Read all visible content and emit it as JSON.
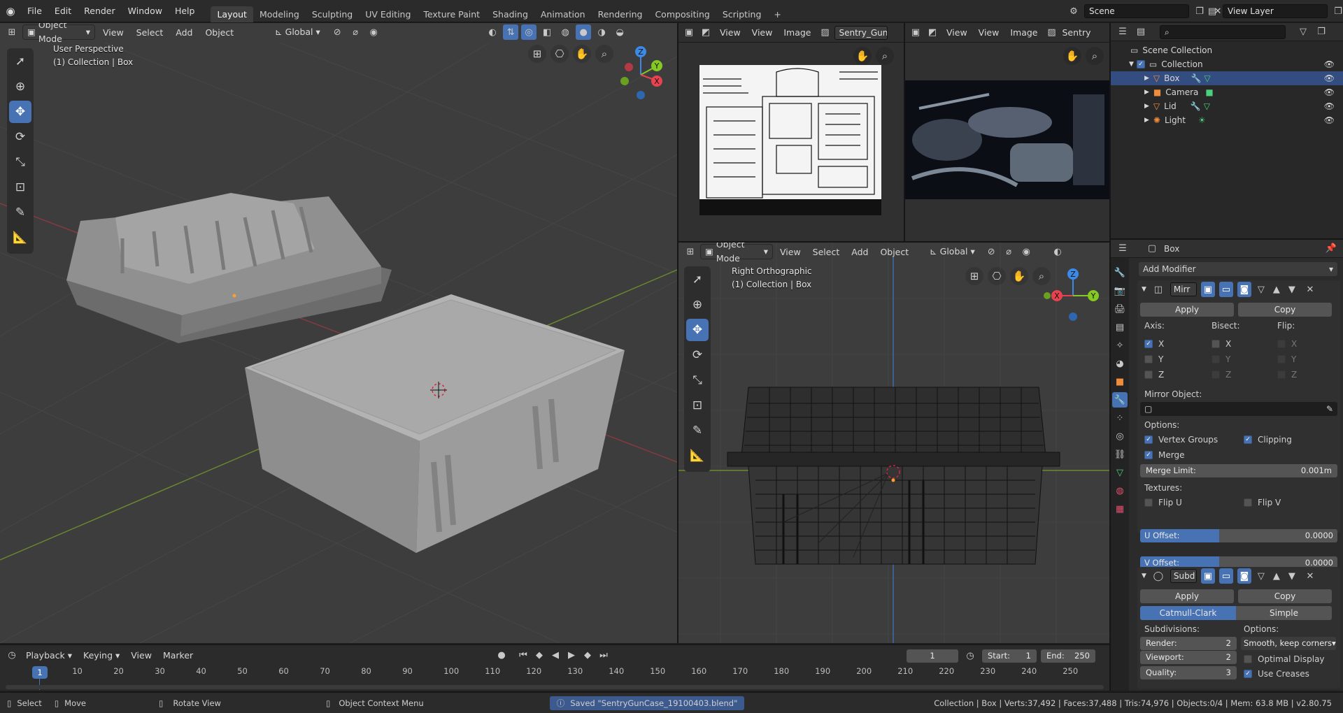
{
  "topbar": {
    "menus": [
      "File",
      "Edit",
      "Render",
      "Window",
      "Help"
    ],
    "workspaces": [
      "Layout",
      "Modeling",
      "Sculpting",
      "UV Editing",
      "Texture Paint",
      "Shading",
      "Animation",
      "Rendering",
      "Compositing",
      "Scripting"
    ],
    "active_workspace": "Layout",
    "add_tab": "+",
    "scene": "Scene",
    "view_layer": "View Layer"
  },
  "viewport_left": {
    "mode": "Object Mode",
    "menus": [
      "View",
      "Select",
      "Add",
      "Object"
    ],
    "orientation": "Global",
    "title": "User Perspective",
    "collection": "(1) Collection | Box",
    "gizmo": {
      "z": "Z",
      "y": "Y",
      "x": "X"
    }
  },
  "image_editor_1": {
    "menus": [
      "View",
      "View",
      "Image"
    ],
    "image_name": "Sentry_Gun_C"
  },
  "image_editor_2": {
    "menus": [
      "View",
      "View",
      "Image"
    ],
    "image_name": "Sentry"
  },
  "viewport_right": {
    "mode": "Object Mode",
    "menus": [
      "View",
      "Select",
      "Add",
      "Object"
    ],
    "orientation": "Global",
    "title": "Right Orthographic",
    "collection": "(1) Collection | Box",
    "gizmo": {
      "z": "Z",
      "y": "Y",
      "x": "X"
    }
  },
  "outliner": {
    "items": [
      {
        "label": "Scene Collection",
        "icon": "scene-collection-icon",
        "level": 0
      },
      {
        "label": "Collection",
        "icon": "collection-icon",
        "level": 1
      },
      {
        "label": "Box",
        "icon": "mesh-object-icon",
        "level": 2,
        "selected": true
      },
      {
        "label": "Camera",
        "icon": "camera-object-icon",
        "level": 2
      },
      {
        "label": "Lid",
        "icon": "mesh-object-icon",
        "level": 2
      },
      {
        "label": "Light",
        "icon": "light-object-icon",
        "level": 2
      }
    ]
  },
  "properties": {
    "object_name": "Box",
    "add_modifier": "Add Modifier",
    "mirror": {
      "name": "Mirr",
      "apply": "Apply",
      "copy": "Copy",
      "axis_label": "Axis:",
      "bisect_label": "Bisect:",
      "flip_label": "Flip:",
      "axes": [
        "X",
        "Y",
        "Z"
      ],
      "axis_checked": [
        true,
        false,
        false
      ],
      "mirror_object_label": "Mirror Object:",
      "options_label": "Options:",
      "vertex_groups": "Vertex Groups",
      "clipping": "Clipping",
      "merge": "Merge",
      "merge_limit_label": "Merge Limit:",
      "merge_limit_value": "0.001m",
      "textures_label": "Textures:",
      "flip_u": "Flip U",
      "flip_v": "Flip V",
      "u_offset_label": "U Offset:",
      "u_offset_value": "0.0000",
      "v_offset_label": "V Offset:",
      "v_offset_value": "0.0000"
    },
    "subsurf": {
      "name": "Subd",
      "apply": "Apply",
      "copy": "Copy",
      "catmull": "Catmull-Clark",
      "simple": "Simple",
      "subdivisions_label": "Subdivisions:",
      "options_label": "Options:",
      "render_label": "Render:",
      "render_value": "2",
      "viewport_label": "Viewport:",
      "viewport_value": "2",
      "quality_label": "Quality:",
      "quality_value": "3",
      "uv_smooth": "Smooth, keep corners",
      "optimal_display": "Optimal Display",
      "use_creases": "Use Creases"
    }
  },
  "timeline": {
    "menus": [
      "Playback",
      "Keying",
      "View",
      "Marker"
    ],
    "current_frame": "1",
    "start_label": "Start:",
    "start": "1",
    "end_label": "End:",
    "end": "250",
    "ticks": [
      "1",
      "10",
      "20",
      "30",
      "40",
      "50",
      "60",
      "70",
      "80",
      "90",
      "100",
      "110",
      "120",
      "130",
      "140",
      "150",
      "160",
      "170",
      "180",
      "190",
      "200",
      "210",
      "220",
      "230",
      "240",
      "250"
    ]
  },
  "statusbar": {
    "select": "Select",
    "move": "Move",
    "rotate": "Rotate View",
    "context": "Object Context Menu",
    "message": "Saved \"SentryGunCase_19100403.blend\"",
    "stats": "Collection | Box | Verts:37,492 | Faces:37,488 | Tris:74,976 | Objects:0/4 | Mem: 63.8 MB | v2.80.75"
  },
  "colors": {
    "accent": "#4772b3",
    "axis_x": "#e8424f",
    "axis_y": "#86c922",
    "axis_z": "#3d8ae6",
    "background": "#1d1d1d"
  }
}
